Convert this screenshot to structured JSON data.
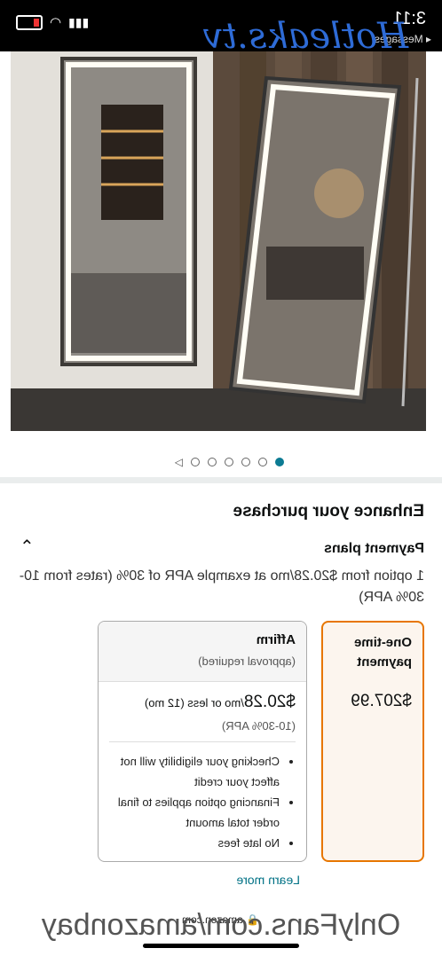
{
  "status_bar": {
    "time": "3:11",
    "back_label": "◂ Messages"
  },
  "watermarks": {
    "top": "Hotleaks.tv",
    "bottom": "OnlyFans.com/amazonbay"
  },
  "gallery": {
    "dot_count": 6,
    "active_dot": 0
  },
  "enhance": {
    "heading": "Enhance your purchase",
    "payment_plans_title": "Payment plans",
    "payment_plans_desc": "1 option from $20.28/mo at example APR of 30% (rates from 10-30% APR)"
  },
  "options": {
    "one_time": {
      "title": "One-time payment",
      "price": "$207.99"
    },
    "affirm": {
      "name": "Affirm",
      "approval": "(approval required)",
      "monthly": "$20.28",
      "terms": "/mo or less (12 mo)",
      "apr": "(10-30% APR)",
      "bullets": [
        "Checking your eligibility will not affect your credit",
        "Financing option applies to final order total amount",
        "No late fees"
      ]
    },
    "learn_more": "Learn more"
  },
  "footer": {
    "domain": "🔒 amazon.com"
  },
  "colors": {
    "accent_teal": "#007185",
    "selected_border": "#e77600"
  }
}
